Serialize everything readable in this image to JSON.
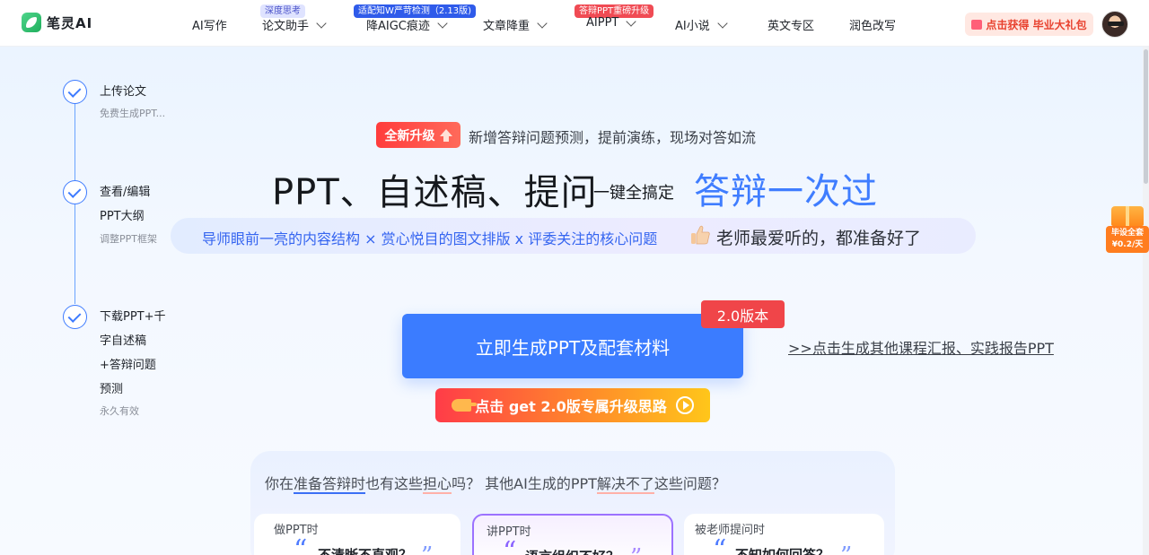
{
  "header": {
    "logo_text": "笔灵AI",
    "nav": [
      {
        "label": "AI写作",
        "has_dropdown": false
      },
      {
        "label": "论文助手",
        "has_dropdown": true,
        "badge": "深度思考"
      },
      {
        "label": "降AIGC痕迹",
        "has_dropdown": true,
        "badge": "适配知W严苛检测（2.13版)"
      },
      {
        "label": "文章降重",
        "has_dropdown": true
      },
      {
        "label": "AIPPT",
        "has_dropdown": true,
        "badge": "答辩PPT重磅升级"
      },
      {
        "label": "AI小说",
        "has_dropdown": true
      },
      {
        "label": "英文专区",
        "has_dropdown": false
      },
      {
        "label": "润色改写",
        "has_dropdown": false
      }
    ],
    "promo": "点击获得 毕业大礼包"
  },
  "steps": [
    {
      "title": "上传论文",
      "lines": [],
      "sub": "免费生成PPT..."
    },
    {
      "title": "查看/编辑",
      "lines": [
        "PPT大纲"
      ],
      "sub": "调整PPT框架"
    },
    {
      "title": "下载PPT+千",
      "lines": [
        "字自述稿",
        "+答辩问题",
        "预测"
      ],
      "sub": "永久有效"
    }
  ],
  "hero": {
    "tag": "全新升级",
    "subtitle": "新增答辩问题预测，提前演练，现场对答如流",
    "title": "PPT、自述稿、提问",
    "title_mid": "一键全搞定",
    "title_highlight": "答辩一次过",
    "pill_blue": "导师眼前一亮的内容结构 × 赏心悦目的图文排版 x 评委关注的核心问题",
    "pill_dark": "老师最爱听的，都准备好了"
  },
  "cta": {
    "main_label": "立即生成PPT及配套材料",
    "version_tag": "2.0版本",
    "other_link": ">>点击生成其他课程汇报、实践报告PPT",
    "upgrade_label": "点击 get 2.0版专属升级思路"
  },
  "side_gift": {
    "line1": "毕设全套",
    "line2": "¥0.2/天"
  },
  "panel": {
    "question_parts": [
      "你在",
      "准备答辩时",
      "也有这些",
      "担心",
      "吗？  其他AI生成的PPT",
      "解决不了",
      "这些问题？"
    ],
    "cards": [
      {
        "title": "做PPT时",
        "problem": "不清晰不直观？"
      },
      {
        "title": "讲PPT时",
        "problem": "语言组织不好？"
      },
      {
        "title": "被老师提问时",
        "problem": "不知如何回答？"
      }
    ]
  },
  "colors": {
    "accent": "#3b7cff",
    "hero_blue": "#3f7dff",
    "red": "#f04549",
    "purple": "#9c72ff"
  }
}
